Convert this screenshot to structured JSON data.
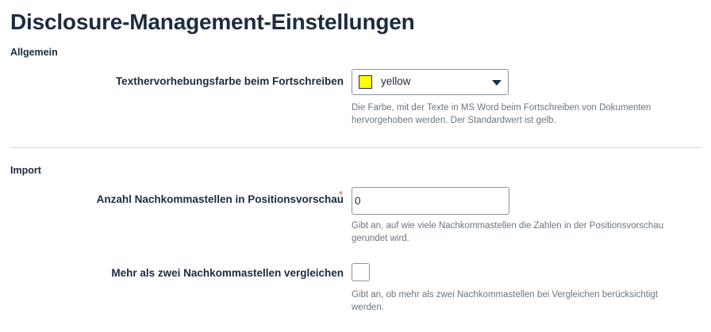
{
  "page": {
    "title": "Disclosure-Management-Einstellungen"
  },
  "sections": {
    "general": {
      "label": "Allgemein",
      "highlight_color": {
        "label": "Texthervorhebungsfarbe beim Fortschreiben",
        "selected_value": "yellow",
        "swatch_color": "#ffff00",
        "help": "Die Farbe, mit der Texte in MS Word beim Fortschreiben von Dokumenten hervorgehoben werden. Der Standardwert ist gelb."
      }
    },
    "import": {
      "label": "Import",
      "decimal_places": {
        "label": "Anzahl Nachkommastellen in Positionsvorschau",
        "required_marker": "*",
        "value": "0",
        "help": "Gibt an, auf wie viele Nachkommastellen die Zahlen in der Positionsvorschau gerundet wird."
      },
      "compare_decimals": {
        "label": "Mehr als zwei Nachkommastellen vergleichen",
        "checked": false,
        "help": "Gibt an, ob mehr als zwei Nachkommastellen bei Vergleichen berücksichtigt werden."
      }
    }
  },
  "colors": {
    "text_primary": "#1c2c3e",
    "text_help": "#6b7580",
    "required": "#d9534f",
    "border": "#8a939c",
    "divider": "#d3d6da"
  }
}
